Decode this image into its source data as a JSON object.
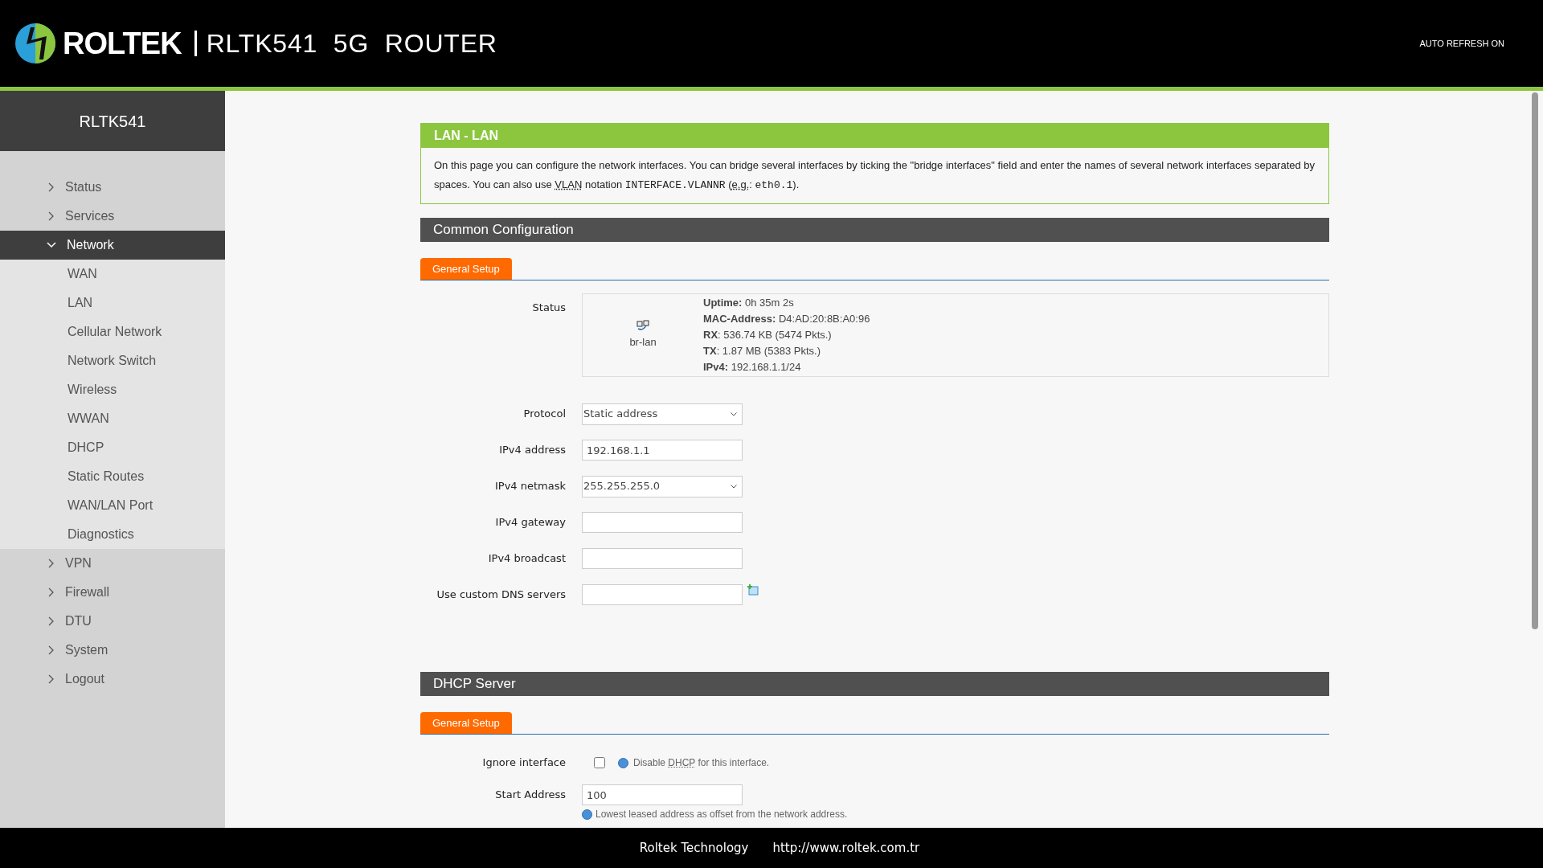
{
  "header": {
    "brand": "ROLTEK",
    "product": "RLTK541 5G ROUTER",
    "auto_refresh": "AUTO REFRESH ON"
  },
  "sidebar": {
    "title": "RLTK541",
    "items": [
      {
        "label": "Status",
        "expanded": false,
        "selected": false
      },
      {
        "label": "Services",
        "expanded": false,
        "selected": false
      },
      {
        "label": "Network",
        "expanded": true,
        "selected": true,
        "children": [
          {
            "label": "WAN"
          },
          {
            "label": "LAN"
          },
          {
            "label": "Cellular Network"
          },
          {
            "label": "Network Switch"
          },
          {
            "label": "Wireless"
          },
          {
            "label": "WWAN"
          },
          {
            "label": "DHCP"
          },
          {
            "label": "Static Routes"
          },
          {
            "label": "WAN/LAN Port"
          },
          {
            "label": "Diagnostics"
          }
        ]
      },
      {
        "label": "VPN",
        "expanded": false,
        "selected": false
      },
      {
        "label": "Firewall",
        "expanded": false,
        "selected": false
      },
      {
        "label": "DTU",
        "expanded": false,
        "selected": false
      },
      {
        "label": "System",
        "expanded": false,
        "selected": false
      },
      {
        "label": "Logout",
        "expanded": false,
        "selected": false
      }
    ]
  },
  "info_box": {
    "title": "LAN - LAN",
    "description": [
      {
        "kind": "text",
        "text": "On this page you can configure the network interfaces. You can bridge several interfaces by ticking the \"bridge interfaces\" field and enter the names of several network interfaces separated by spaces. You can also use "
      },
      {
        "kind": "abbr",
        "text": "VLAN"
      },
      {
        "kind": "text",
        "text": " notation "
      },
      {
        "kind": "code",
        "text": "INTERFACE.VLANNR"
      },
      {
        "kind": "text",
        "text": " ("
      },
      {
        "kind": "abbr",
        "text": "e.g."
      },
      {
        "kind": "text",
        "text": ": "
      },
      {
        "kind": "code",
        "text": "eth0.1"
      },
      {
        "kind": "text",
        "text": ")."
      }
    ]
  },
  "common_configuration": {
    "title": "Common Configuration",
    "tabs": [
      {
        "label": "General Setup",
        "selected": true
      }
    ],
    "status": {
      "label": "Status",
      "device": "br-lan",
      "details": [
        "**Uptime:** 0h 35m 2s",
        "**MAC-Address:** D4:AD:20:8B:A0:96",
        "**RX**: 536.74 KB (5474 Pkts.)",
        "**TX**: 1.87 MB (5383 Pkts.)",
        "**IPv4:** 192.168.1.1/24"
      ]
    },
    "fields": [
      {
        "kind": "select",
        "label": "Protocol",
        "value": "Static address"
      },
      {
        "kind": "text",
        "label": "IPv4 address",
        "value": "192.168.1.1"
      },
      {
        "kind": "select",
        "label": "IPv4 netmask",
        "value": "255.255.255.0"
      },
      {
        "kind": "text",
        "label": "IPv4 gateway"
      },
      {
        "kind": "text",
        "label": "IPv4 broadcast"
      },
      {
        "kind": "dynlist",
        "label": "Use custom DNS servers"
      }
    ]
  },
  "dhcp_server": {
    "title": "DHCP Server",
    "tabs": [
      {
        "label": "General Setup",
        "selected": true
      }
    ],
    "fields": [
      {
        "kind": "checkbox",
        "label": "Ignore interface",
        "checked": false,
        "hint": [
          {
            "kind": "text",
            "text": "Disable "
          },
          {
            "kind": "abbr",
            "text": "DHCP"
          },
          {
            "kind": "text",
            "text": " for this interface."
          }
        ]
      },
      {
        "kind": "text",
        "label": "Start Address",
        "value": "100",
        "hint": [
          {
            "kind": "text",
            "text": "Lowest leased address as offset from the network address."
          }
        ]
      }
    ]
  },
  "footer": {
    "company": "Roltek Technology",
    "url": "http://www.roltek.com.tr"
  }
}
